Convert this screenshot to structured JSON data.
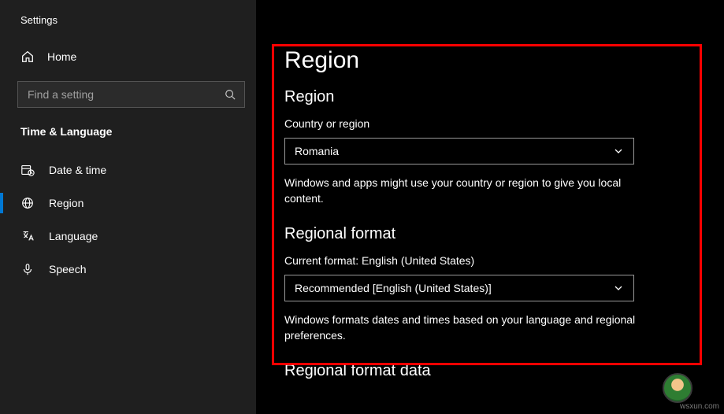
{
  "app_title": "Settings",
  "home_label": "Home",
  "search": {
    "placeholder": "Find a setting"
  },
  "category_title": "Time & Language",
  "nav": {
    "items": [
      {
        "label": "Date & time"
      },
      {
        "label": "Region"
      },
      {
        "label": "Language"
      },
      {
        "label": "Speech"
      }
    ]
  },
  "page_title": "Region",
  "region": {
    "section_title": "Region",
    "field_label": "Country or region",
    "selected": "Romania",
    "description": "Windows and apps might use your country or region to give you local content."
  },
  "regional_format": {
    "section_title": "Regional format",
    "field_label": "Current format: English (United States)",
    "selected": "Recommended [English (United States)]",
    "description": "Windows formats dates and times based on your language and regional preferences."
  },
  "regional_format_data": {
    "section_title": "Regional format data"
  },
  "watermark": "wsxun.com"
}
